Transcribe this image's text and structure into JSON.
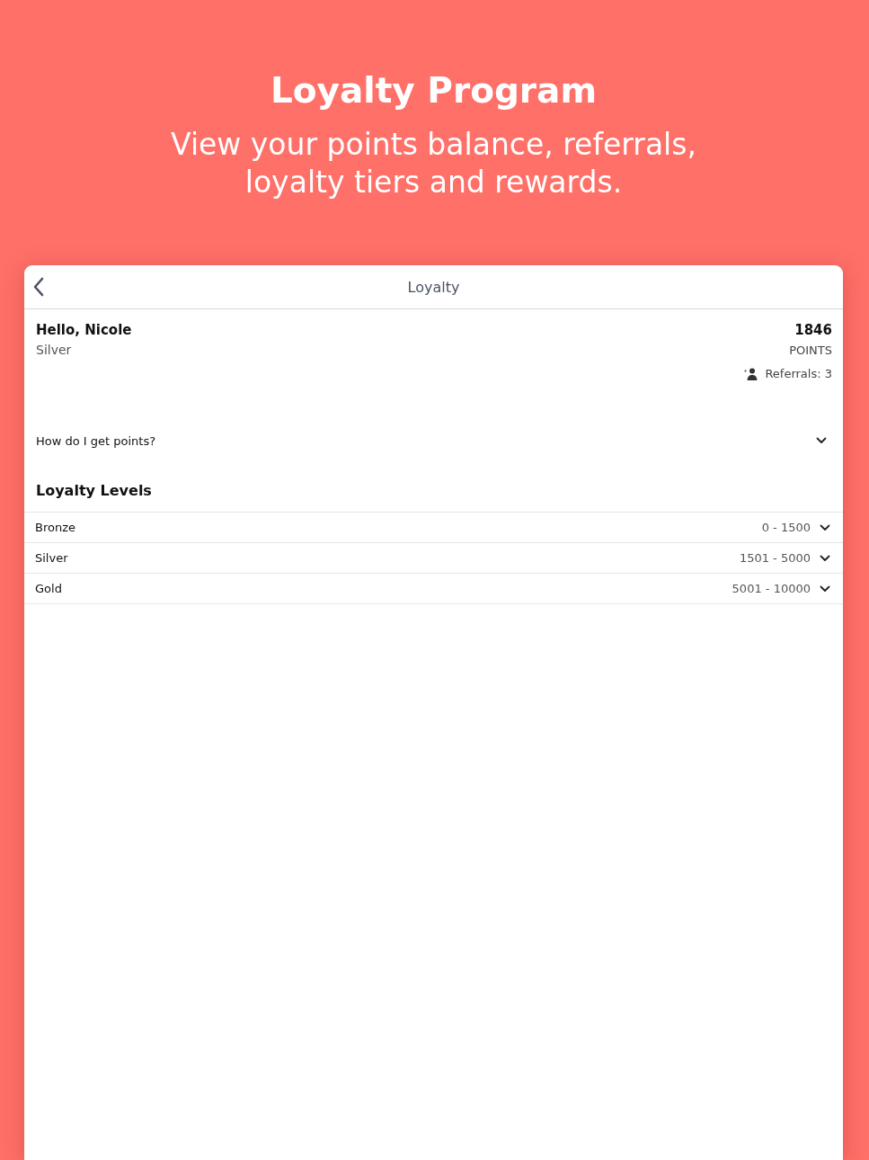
{
  "header": {
    "title": "Loyalty Program",
    "subtitle": "View your points balance, referrals, loyalty tiers and rewards."
  },
  "nav": {
    "title": "Loyalty"
  },
  "member": {
    "greeting": "Hello, Nicole",
    "tier": "Silver",
    "points": "1846",
    "points_label": "POINTS",
    "referrals": "Referrals: 3"
  },
  "faq": {
    "question": "How do I get points?",
    "expanded": false
  },
  "levels": {
    "heading": "Loyalty Levels",
    "items": [
      {
        "name": "Bronze",
        "range": "0 - 1500",
        "expanded": false
      },
      {
        "name": "Silver",
        "range": "1501 - 5000",
        "expanded": false
      },
      {
        "name": "Gold",
        "range": "5001 - 10000",
        "expanded": false
      }
    ]
  }
}
